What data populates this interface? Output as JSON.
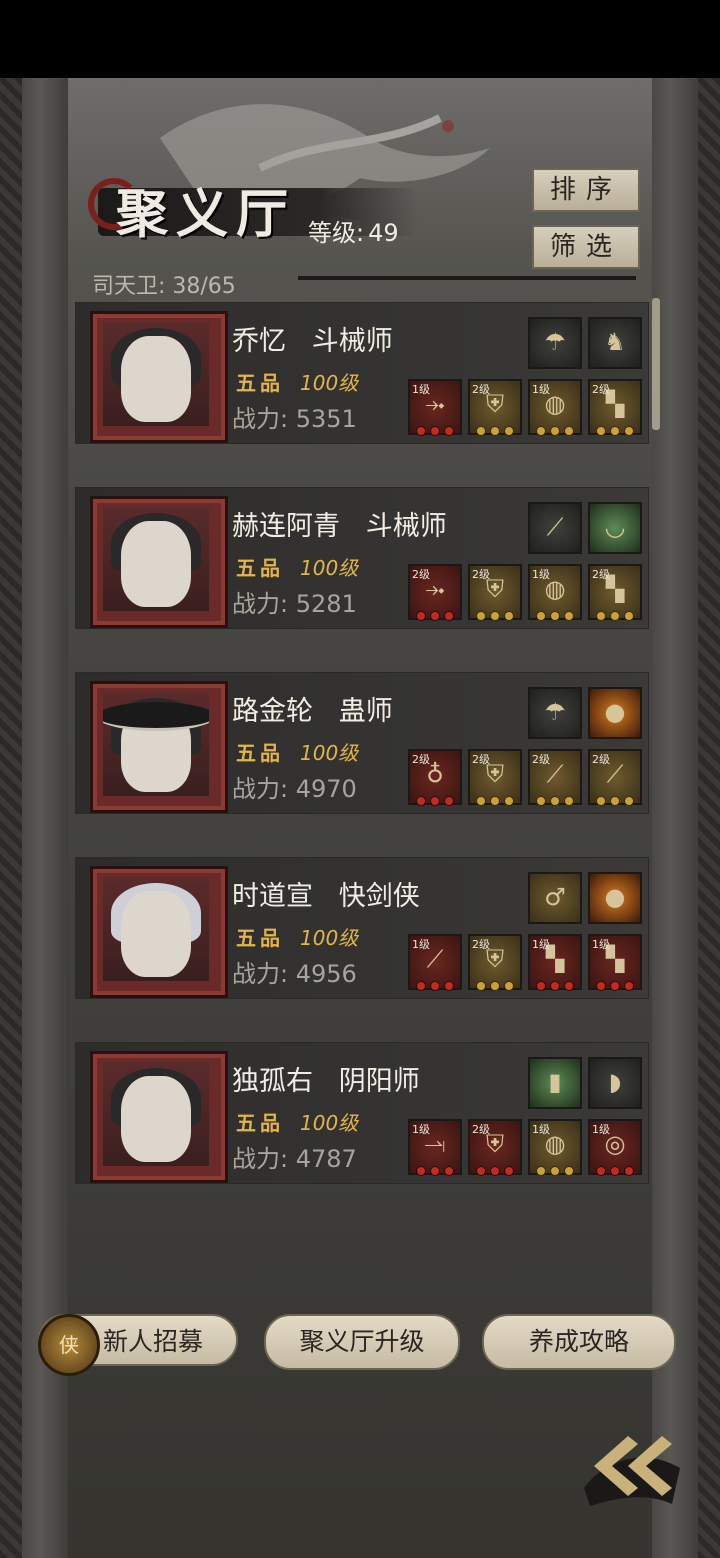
{
  "hall": {
    "title": "聚义厅",
    "level_label": "等级:",
    "level_value": "49",
    "guard_label": "司天卫: 38/65",
    "sort_label": "排序",
    "filter_label": "筛选"
  },
  "heroes": [
    {
      "name": "乔忆   斗械师",
      "grade": "五品",
      "level": "100级",
      "power": "战力: 5351",
      "top_gear": [
        {
          "icon": "mushroom",
          "bg": "e-dark"
        },
        {
          "icon": "wolf",
          "bg": "e-dark"
        }
      ],
      "gear": [
        {
          "tag": "1级",
          "icon": "crossbow",
          "bg": "e-red",
          "dots": "red"
        },
        {
          "tag": "2级",
          "icon": "armor",
          "bg": "e-gold",
          "dots": "gold"
        },
        {
          "tag": "1级",
          "icon": "helmet",
          "bg": "e-gold",
          "dots": "gold"
        },
        {
          "tag": "2级",
          "icon": "boots",
          "bg": "e-gold",
          "dots": "gold"
        }
      ]
    },
    {
      "name": "赫连阿青   斗械师",
      "grade": "五品",
      "level": "100级",
      "power": "战力: 5281",
      "top_gear": [
        {
          "icon": "spear",
          "bg": "e-dark"
        },
        {
          "icon": "bowl",
          "bg": "e-green"
        }
      ],
      "gear": [
        {
          "tag": "2级",
          "icon": "crossbow",
          "bg": "e-red",
          "dots": "red"
        },
        {
          "tag": "2级",
          "icon": "armor",
          "bg": "e-gold",
          "dots": "gold"
        },
        {
          "tag": "1级",
          "icon": "helmet",
          "bg": "e-gold",
          "dots": "gold"
        },
        {
          "tag": "2级",
          "icon": "boots",
          "bg": "e-gold",
          "dots": "gold"
        }
      ]
    },
    {
      "name": "路金轮   蛊师",
      "grade": "五品",
      "level": "100级",
      "power": "战力: 4970",
      "top_gear": [
        {
          "icon": "mushroom",
          "bg": "e-dark"
        },
        {
          "icon": "amber",
          "bg": "e-amber"
        }
      ],
      "gear": [
        {
          "tag": "2级",
          "icon": "gourd",
          "bg": "e-red",
          "dots": "red"
        },
        {
          "tag": "2级",
          "icon": "armor",
          "bg": "e-gold",
          "dots": "gold"
        },
        {
          "tag": "2级",
          "icon": "staff",
          "bg": "e-gold",
          "dots": "gold"
        },
        {
          "tag": "2级",
          "icon": "staff",
          "bg": "e-gold",
          "dots": "gold"
        }
      ]
    },
    {
      "name": "时道宣   快剑侠",
      "grade": "五品",
      "level": "100级",
      "power": "战力: 4956",
      "top_gear": [
        {
          "icon": "ladle",
          "bg": "e-gold"
        },
        {
          "icon": "amber",
          "bg": "e-amber"
        }
      ],
      "gear": [
        {
          "tag": "1级",
          "icon": "sword",
          "bg": "e-red",
          "dots": "red"
        },
        {
          "tag": "2级",
          "icon": "robe",
          "bg": "e-gold",
          "dots": "gold"
        },
        {
          "tag": "1级",
          "icon": "boots",
          "bg": "e-red",
          "dots": "red"
        },
        {
          "tag": "1级",
          "icon": "boots",
          "bg": "e-red",
          "dots": "red"
        }
      ]
    },
    {
      "name": "独孤右   阴阳师",
      "grade": "五品",
      "level": "100级",
      "power": "战力: 4787",
      "top_gear": [
        {
          "icon": "jade",
          "bg": "e-green"
        },
        {
          "icon": "fossil",
          "bg": "e-dark"
        }
      ],
      "gear": [
        {
          "tag": "1级",
          "icon": "scythe",
          "bg": "e-red",
          "dots": "red"
        },
        {
          "tag": "2级",
          "icon": "robe",
          "bg": "e-red",
          "dots": "red"
        },
        {
          "tag": "1级",
          "icon": "helmet",
          "bg": "e-gold",
          "dots": "gold"
        },
        {
          "tag": "1级",
          "icon": "ring",
          "bg": "e-red",
          "dots": "red"
        }
      ]
    }
  ],
  "bottom": {
    "recruit_label": "新人招募",
    "upgrade_label": "聚义厅升级",
    "guide_label": "养成攻略",
    "seal_glyph": "侠"
  }
}
